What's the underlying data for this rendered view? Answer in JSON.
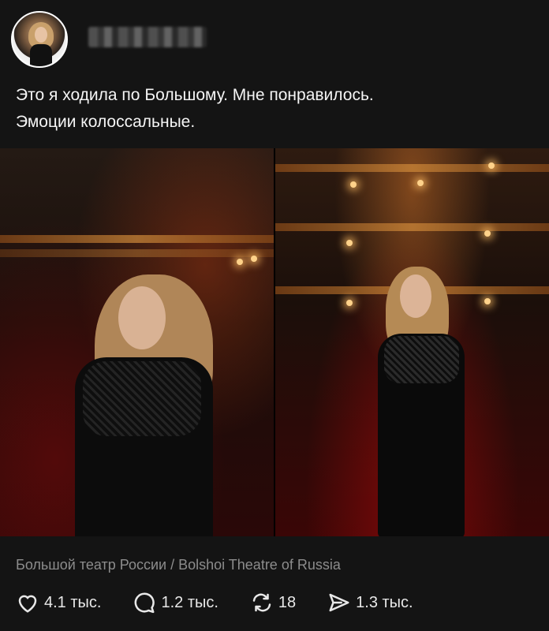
{
  "post": {
    "text_line1": "Это я ходила по Большому. Мне понравилось.",
    "text_line2": "Эмоции колоссальные."
  },
  "location": "Большой театр России / Bolshoi Theatre of Russia",
  "actions": {
    "likes": "4.1 тыс.",
    "comments": "1.2 тыс.",
    "reposts": "18",
    "shares": "1.3 тыс."
  },
  "icons": [
    "heart-icon",
    "comment-icon",
    "repost-icon",
    "share-icon"
  ],
  "colors": {
    "background": "#141414",
    "text": "#f2f2f2",
    "muted": "#8c8c8c"
  }
}
